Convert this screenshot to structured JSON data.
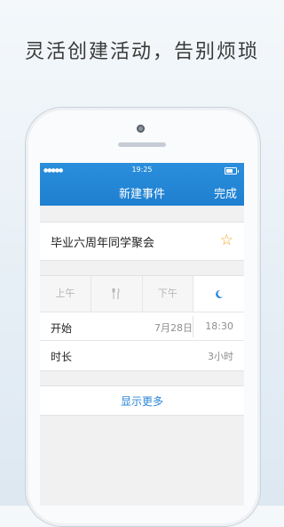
{
  "headline": "灵活创建活动，告别烦琐",
  "status_bar": {
    "signal": "●●●●●",
    "time": "19:25"
  },
  "navbar": {
    "title": "新建事件",
    "done_label": "完成"
  },
  "event": {
    "title": "毕业六周年同学聚会",
    "star_icon": "star-outline-icon"
  },
  "time_segments": [
    {
      "label": "上午",
      "icon": ""
    },
    {
      "label": "",
      "icon": "fork-knife-icon"
    },
    {
      "label": "下午",
      "icon": ""
    },
    {
      "label": "",
      "icon": "moon-icon"
    }
  ],
  "start": {
    "label": "开始",
    "date": "7月28日",
    "time": "18:30"
  },
  "duration": {
    "label": "时长",
    "value": "3小时"
  },
  "show_more_label": "显示更多",
  "colors": {
    "nav_blue": "#1f7fd0",
    "accent": "#2a86d6",
    "star": "#f2a516"
  }
}
